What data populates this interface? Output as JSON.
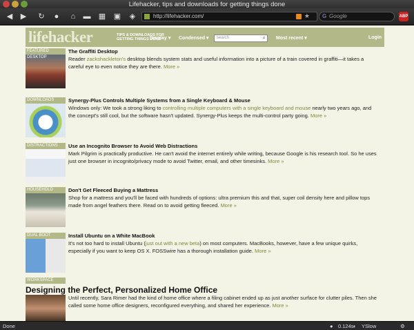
{
  "window": {
    "title": "Lifehacker, tips and downloads for getting things done"
  },
  "toolbar": {
    "url": "http://lifehacker.com/",
    "search_placeholder": "Google",
    "adblock_label": "ABP"
  },
  "site": {
    "logo": "lifehacker",
    "tagline": "TIPS & DOWNLOADS FOR GETTING THINGS DONE",
    "nav": {
      "display": "Display ▾",
      "condensed": "Condensed ▾",
      "search_placeholder": "search",
      "most_recent": "Most recent ▾",
      "login": "Login"
    }
  },
  "articles": [
    {
      "category": "FEATURED DESKTOP",
      "title": "The Graffiti Desktop",
      "body_pre": "Reader ",
      "link": "zackshackleton's",
      "body_post": " desktop blends system stats and useful information into a picture of a train covered in graffiti—it takes a careful eye to even notice they are there. ",
      "more": "More »"
    },
    {
      "category": "DOWNLOADS",
      "title": "Synergy-Plus Controls Multiple Systems from a Single Keyboard & Mouse",
      "body_pre": "Windows only: We took a strong liking to ",
      "link": "controlling multiple computers with a single keyboard and mouse",
      "body_post": " nearly two years ago, and the concept's still cool, but the software hasn't updated. Synergy-Plus keeps the multi-control party going. ",
      "more": "More »"
    },
    {
      "category": "DISTRACTIONS",
      "title": "Use an Incognito Browser to Avoid Web Distractions",
      "body_pre": "Mark Pilgrim is practically productive. He can't avoid the internet entirely while writing, because Google is his research tool. So he uses just one browser in incognito/privacy mode to avoid Twitter, email, and other timesinks. ",
      "link": "",
      "body_post": "",
      "more": "More »"
    },
    {
      "category": "HOUSEHOLD",
      "title": "Don't Get Fleeced Buying a Mattress",
      "body_pre": "Shop for a mattress and you'll be faced with hundreds of options: ultra premium this and that, super coil density here and pillow tops made from angel feathers there. Read on to avoid getting fleeced. ",
      "link": "",
      "body_post": "",
      "more": "More »"
    },
    {
      "category": "DUAL BOOT",
      "title": "Install Ubuntu on a White MacBook",
      "body_pre": "It's not too hard to install Ubuntu (",
      "link": "just out with a new beta",
      "body_post": ") on most computers. MacBooks, however, have a few unique quirks, especially if you want to keep OS X. FOSSwire has a thorough installation guide. ",
      "more": "More »"
    }
  ],
  "featured": {
    "category": "WORKSPACE",
    "title": "Designing the Perfect, Personalized Home Office",
    "body": "Until recently, Sara Rimer had the kind of home office where a filing cabinet ended up as just another surface for clutter piles. Then she called some home office designers, reconfigured everything, and shared her experience. ",
    "more": "More »"
  },
  "status": {
    "left": "Done",
    "timing": "0.124s",
    "yslow": "YSlow"
  },
  "colors": {
    "accent": "#b2b888",
    "link": "#7a8a3a",
    "page_bg": "#f3f3e6"
  }
}
